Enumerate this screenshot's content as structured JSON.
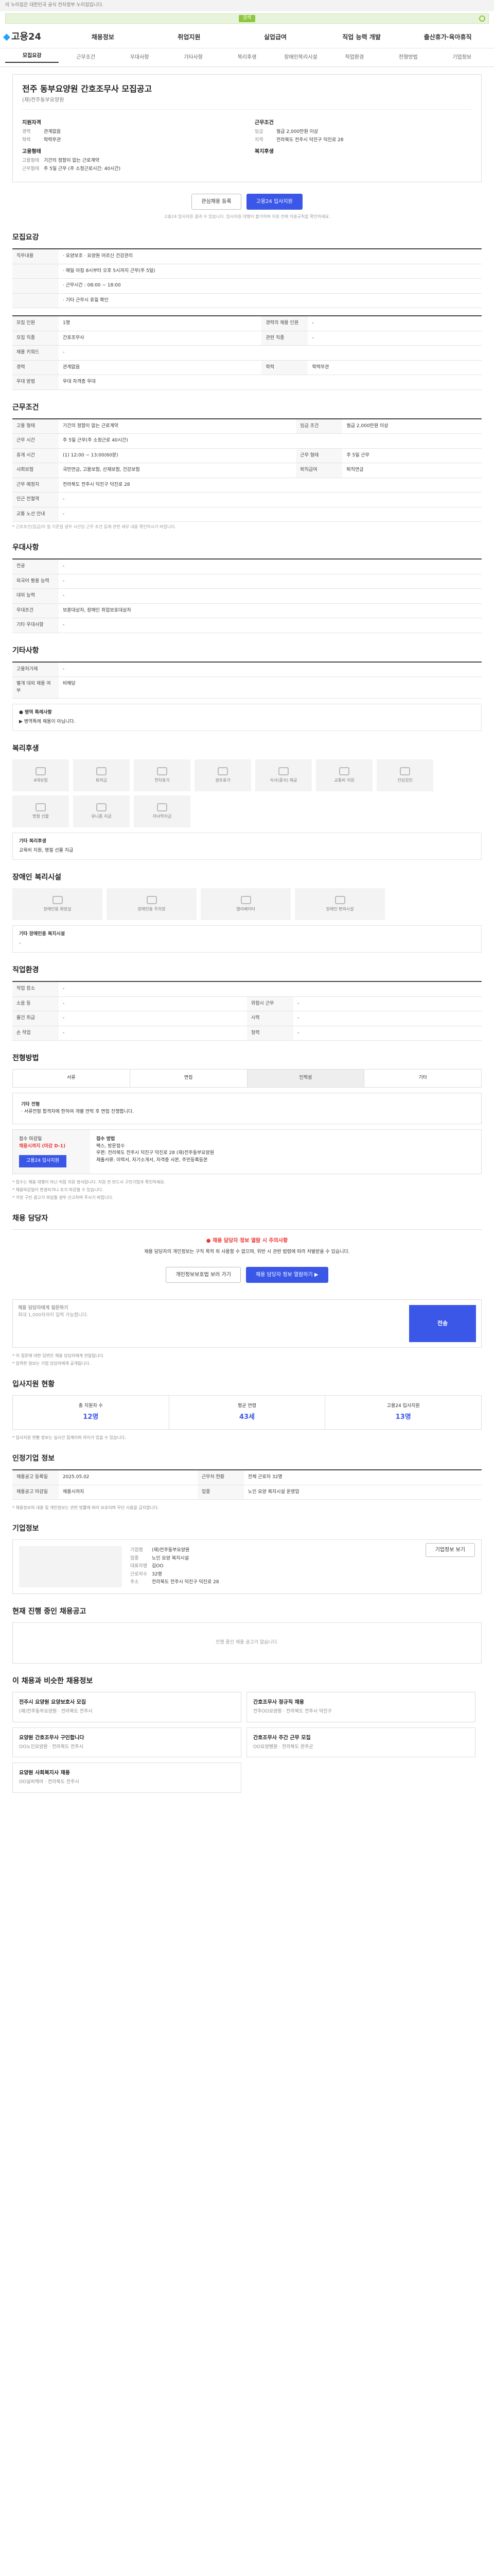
{
  "banner_text": "이 누리집은 대한민국 공식 전자정부 누리집입니다.",
  "search_label": "검색",
  "logo_text": "고용24",
  "gnb": [
    "채용정보",
    "취업지원",
    "실업급여",
    "직업 능력 개발",
    "출산휴가·육아휴직"
  ],
  "tabs": [
    "모집요강",
    "근무조건",
    "우대사항",
    "기타사항",
    "복리후생",
    "장애인복리시설",
    "직업환경",
    "전형방법",
    "기업정보"
  ],
  "hero": {
    "title": "전주 동부요양원 간호조무사 모집공고",
    "company": "(재)전주동부요양원",
    "req_title": "지원자격",
    "req": [
      [
        "경력",
        "관계없음"
      ],
      [
        "학력",
        "학력무관"
      ]
    ],
    "cond_title": "근무조건",
    "cond": [
      [
        "임금",
        "월급 2,000만원 이상"
      ],
      [
        "지역",
        "전라북도 전주시 덕진구 덕진로 28"
      ]
    ],
    "type_title": "고용형태",
    "type": [
      [
        "고용형태",
        "기간의 정함이 없는 근로계약"
      ],
      [
        "근무형태",
        "주 5일 근무 (주 소정근로시간: 40시간)"
      ]
    ],
    "welfare_title": "복지후생"
  },
  "hero_btn_save": "관심채용 등록",
  "hero_btn_apply": "고용24 입사지원",
  "hero_note": "고용24 입사지원 결과 수 있습니다. 입사지원 대행이 불가하며 지원 전에 이용규칙을 확인하세요.",
  "s_recruit": "모집요강",
  "recruit_head": [
    [
      "직무내용",
      "· 요양보조 · 요양원 어르신 건강관리"
    ],
    [
      "",
      "· 매일 아침 8시부터 오후 5시까지 근무(주 5일)"
    ],
    [
      "",
      "· 근무시간 : 08:00 ~ 18:00"
    ],
    [
      "",
      "· 기타 근무시 휴일 확인"
    ]
  ],
  "recruit_rows": [
    [
      "모집 인원",
      "1명",
      "경력의 채용 인원",
      "-"
    ],
    [
      "모집 직종",
      "간호조무사",
      "관련 직종",
      "-"
    ],
    [
      "채용 키워드",
      "-",
      "",
      ""
    ],
    [
      "경력",
      "관계없음",
      "학력",
      "학력무관"
    ],
    [
      "우대 방법",
      "우대 자격증 우대",
      "",
      ""
    ]
  ],
  "s_work": "근무조건",
  "work_rows": [
    [
      "고용 형태",
      "기간의 정함이 없는 근로계약",
      "임금 조건",
      "월급 2,000만원 이상"
    ],
    [
      "근무 시간",
      "주 5일 근무(주 소정근로 40시간)",
      "",
      ""
    ],
    [
      "휴게 시간",
      "(1) 12:00 ~ 13:00(60분)",
      "근무 형태",
      "주 5일 근무"
    ],
    [
      "사회보험",
      "국민연금, 고용보험, 산재보험, 건강보험",
      "퇴직급여",
      "퇴직연금"
    ],
    [
      "근무 예정지",
      "전라북도 전주시 덕진구 덕진로 28",
      "",
      ""
    ],
    [
      "인근 전철역",
      "-",
      "",
      ""
    ],
    [
      "교통 노선 안내",
      "-",
      "",
      ""
    ]
  ],
  "work_note": "* 근로조건(임금)이 일 기준일 경우 시간당 근무 조건 등에 관한 세부 내용 확인하시기 바랍니다.",
  "map_btn": "지도 보기",
  "s_pref": "우대사항",
  "pref_rows": [
    [
      "전공",
      "-"
    ],
    [
      "외국어 활용 능력",
      "-"
    ],
    [
      "대외 능력",
      "-"
    ],
    [
      "우대조건",
      "보훈대상자, 장애인 취업보호대상자"
    ],
    [
      "기타 우대사항",
      "-"
    ]
  ],
  "s_etc": "기타사항",
  "etc_rows": [
    [
      "고용허가제",
      "-"
    ],
    [
      "별개 대외 채용 여부",
      "비해당"
    ]
  ],
  "etc_box_title": "● 병역 특례사항",
  "etc_box": "▶ 병역특례 채용이 아닙니다.",
  "s_welfare": "복리후생",
  "welfare_icons": [
    "4대보험",
    "퇴직금",
    "연차휴가",
    "경조휴가",
    "식사(중식) 제공",
    "교통비 지원",
    "건강검진",
    "명절 선물",
    "유니폼 지급",
    "자녀학자금"
  ],
  "welfare_box_title": "기타 복리후생",
  "welfare_box": "교육비 지원, 명절 선물 지급",
  "s_disabled": "장애인 복리시설",
  "disabled_icons": [
    "장애인용 화장실",
    "장애인용 주차장",
    "엘리베이터",
    "장애인 편의시설"
  ],
  "disabled_box_title": "기타 장애인용 복지시설",
  "disabled_box": "-",
  "s_env": "직업환경",
  "env_rows": [
    [
      "작업 장소",
      "-",
      "",
      ""
    ],
    [
      "소음 등",
      "-",
      "위험시 근무",
      "-"
    ],
    [
      "물건 취급",
      "-",
      "시력",
      "-"
    ],
    [
      "손 작업",
      "-",
      "청력",
      "-"
    ]
  ],
  "s_method": "전형방법",
  "method_filter": [
    "서류",
    "면접",
    "인적성",
    "기타"
  ],
  "method_panel_title": "기타 전형",
  "method_panel": "· 서류전형 합격자에 한하여 개별 연락 후 면접 진행합니다.",
  "method_l_title": "접수 마감일",
  "method_l_date": "채용시까지 (마감 D-1)",
  "method_l_btn": "고용24 입사지원",
  "method_r_title": "접수 방법",
  "method_r": [
    "팩스, 방문접수",
    "우편: 전라북도 전주시 덕진구 덕진로 28 (재)전주동부요양원",
    "제출서류: 이력서, 자기소개서, 자격증 사본, 주민등록등본"
  ],
  "method_bullets": [
    "* 접수는 채용 대행이 아닌 직접 지원 방식입니다. 지원 전 반드시 구인기업과 확인하세요.",
    "* 채용마감일이 변경되거나 조기 마감될 수 있습니다.",
    "* 거짓 구인 광고가 의심될 경우 신고하여 주시기 바랍니다."
  ],
  "s_contact": "채용 담당자",
  "contact_warn": "● 채용 담당자 정보 열람 시 주의사항",
  "contact_text": "채용 담당자의 개인정보는 구직 목적 외 사용할 수 없으며, 위반 시 관련 법령에 따라 처벌받을 수 있습니다.",
  "contact_btn1": "개인정보보호법 보러 가기",
  "contact_btn2": "채용 담당자 정보 열람하기 ▶",
  "ta_label": "채용 담당자에게 질문하기",
  "ta_placeholder": "최대 1,000자까지 입력 가능합니다.",
  "ta_send": "전송",
  "ta_notes": [
    "* 이 질문에 대한 답변은 채용 담당자에게 전달됩니다.",
    "* 입력한 정보는 기업 담당자에게 공개됩니다."
  ],
  "s_status": "입사지원 현황",
  "stats": [
    [
      "총 지원자 수",
      "12명"
    ],
    [
      "평균 연령",
      "43세"
    ],
    [
      "고용24 입사지원",
      "13명"
    ]
  ],
  "stats_note": "* 입사지원 현황 정보는 실시간 집계이며 차이가 있을 수 있습니다.",
  "s_info": "인정기업 정보",
  "info_rows": [
    [
      "채용공고 등록일",
      "2025.05.02",
      "근무처 현황",
      "전체 근로자 32명"
    ],
    [
      "채용공고 마감일",
      "채용시까지",
      "업종",
      "노인 요양 복지시설 운영업"
    ]
  ],
  "info_note": "* 채용정보의 내용 및 개인정보는 관련 법률에 따라 보호되며 무단 사용을 금지합니다.",
  "s_company": "기업정보",
  "company_rows": [
    [
      "기업명",
      "(재)전주동부요양원"
    ],
    [
      "업종",
      "노인 요양 복지시설"
    ],
    [
      "대표자명",
      "김OO"
    ],
    [
      "근로자수",
      "32명"
    ],
    [
      "주소",
      "전라북도 전주시 덕진구 덕진로 28"
    ]
  ],
  "company_btn": "기업정보 보기",
  "s_others": "현재 진행 중인 채용공고",
  "others_empty": "진행 중인 채용 공고가 없습니다.",
  "s_reco": "이 채용과 비슷한 채용정보",
  "reco": [
    [
      "전주시 요양원 요양보호사 모집",
      "(재)전주동부요양원 · 전라북도 전주시"
    ],
    [
      "간호조무사 정규직 채용",
      "전주OO요양원 · 전라북도 전주시 덕진구"
    ],
    [
      "요양원 간호조무사 구인합니다",
      "OO노인요양원 · 전라북도 전주시"
    ],
    [
      "간호조무사 주간 근무 모집",
      "OO요양병원 · 전라북도 완주군"
    ],
    [
      "요양원 사회복지사 채용",
      "OO실버케어 · 전라북도 전주시"
    ]
  ]
}
